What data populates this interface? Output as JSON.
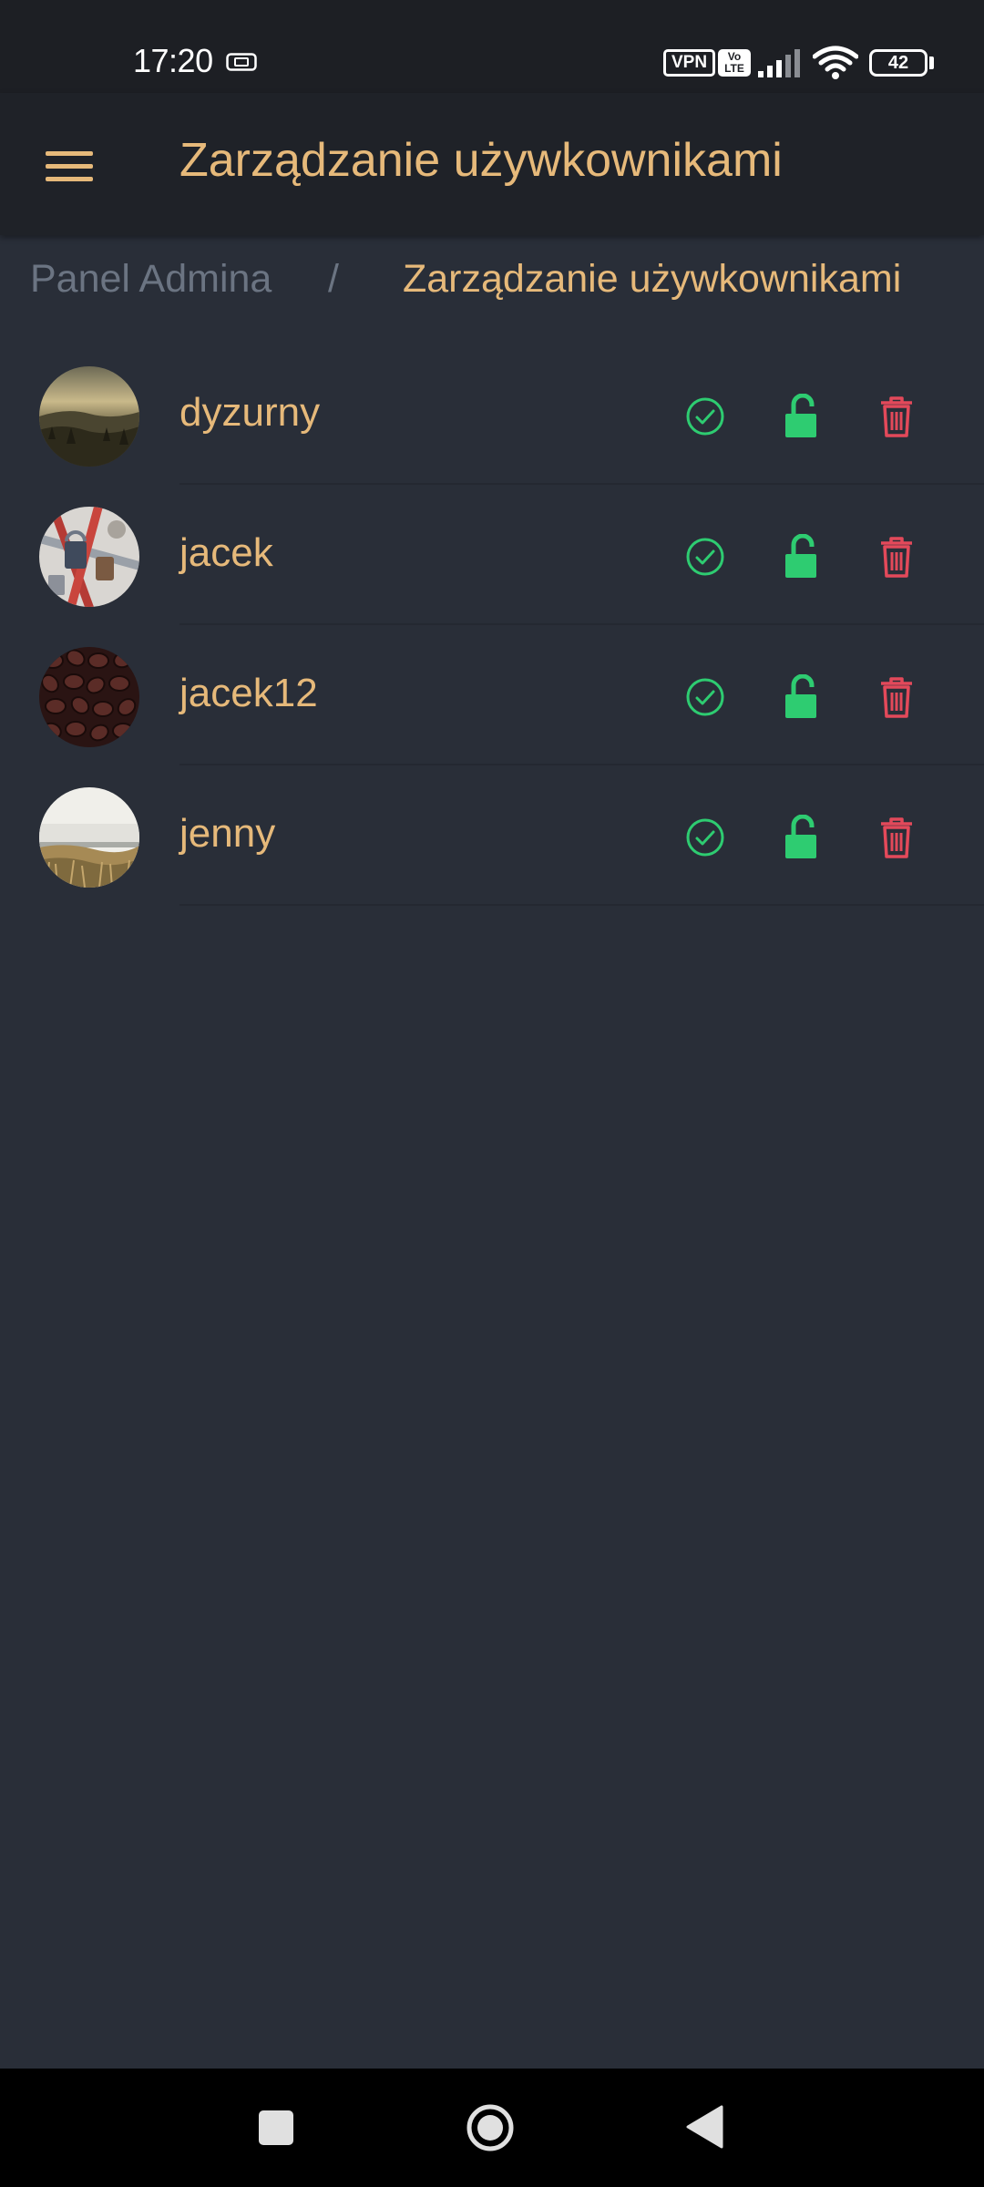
{
  "status_bar": {
    "time": "17:20",
    "vpn": "VPN",
    "volte_top": "Vo",
    "volte_bottom": "LTE",
    "battery": "42"
  },
  "app_bar": {
    "title": "Zarządzanie używkownikami"
  },
  "breadcrumb": {
    "root": "Panel Admina",
    "separator": "/",
    "current": "Zarządzanie używkownikami"
  },
  "colors": {
    "accent": "#e6b97a",
    "success": "#2ecc71",
    "danger": "#e3495a",
    "background": "#292e38"
  },
  "users": [
    {
      "name": "dyzurny",
      "avatar": "landscape-avatar"
    },
    {
      "name": "jacek",
      "avatar": "padlocks-avatar"
    },
    {
      "name": "jacek12",
      "avatar": "coffee-beans-avatar"
    },
    {
      "name": "jenny",
      "avatar": "beach-avatar"
    }
  ]
}
